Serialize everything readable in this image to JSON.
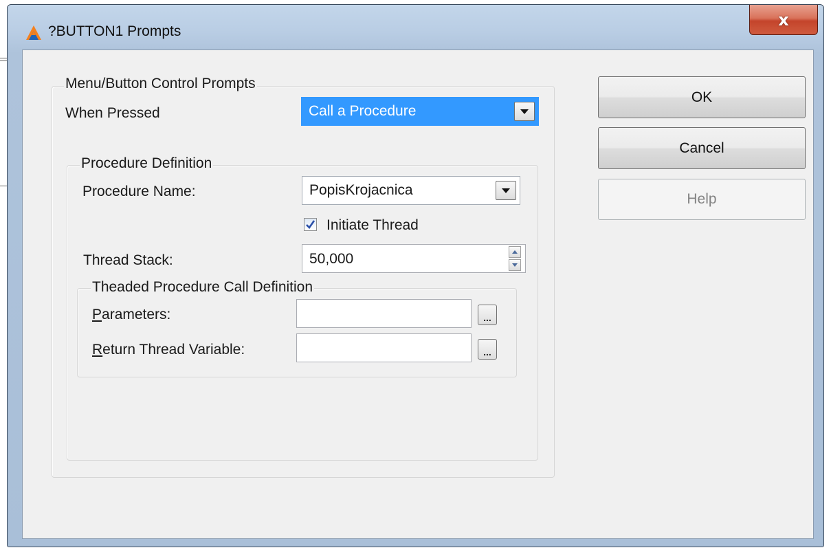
{
  "window": {
    "title": "?BUTTON1 Prompts",
    "close_glyph": "x"
  },
  "menu_group": {
    "legend": "Menu/Button Control Prompts",
    "when_pressed_label": "When Pressed",
    "when_pressed_value": "Call a Procedure"
  },
  "procedure_group": {
    "legend": "Procedure Definition",
    "procedure_name_label": "Procedure Name:",
    "procedure_name_value": "PopisKrojacnica",
    "initiate_thread_label": "Initiate Thread",
    "initiate_thread_checked": true,
    "thread_stack_label": "Thread Stack:",
    "thread_stack_value": "50,000"
  },
  "threaded_group": {
    "legend": "Theaded Procedure Call Definition",
    "parameters_label_first": "P",
    "parameters_label_rest": "arameters:",
    "parameters_value": "",
    "return_label_first": "R",
    "return_label_rest": "eturn Thread Variable:",
    "return_value": "",
    "ellipsis": "..."
  },
  "buttons": {
    "ok": "OK",
    "cancel": "Cancel",
    "help": "Help"
  },
  "colors": {
    "selected_bg": "#3399ff",
    "selected_text": "#ffffff",
    "check_color": "#2a4fa8",
    "icon_orange": "#f4811f",
    "icon_blue": "#2063b5"
  }
}
